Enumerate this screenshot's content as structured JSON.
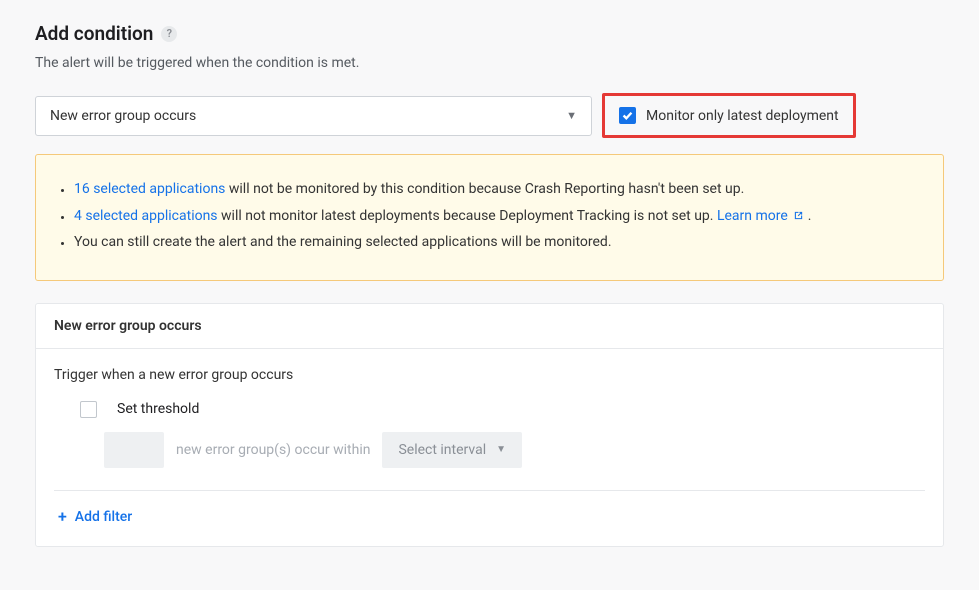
{
  "header": {
    "title": "Add condition",
    "help_icon": "?",
    "subtitle": "The alert will be triggered when the condition is met."
  },
  "condition_select": {
    "value": "New error group occurs"
  },
  "monitor_checkbox": {
    "label": "Monitor only latest deployment",
    "checked": true
  },
  "warning": {
    "items": [
      {
        "link_text": "16 selected applications",
        "text_after": " will not be monitored by this condition because Crash Reporting hasn't been set up."
      },
      {
        "link_text": "4 selected applications",
        "text_after": " will not monitor latest deployments because Deployment Tracking is not set up. ",
        "learn_more": "Learn more",
        "trailing": " ."
      },
      {
        "text_plain": "You can still create the alert and the remaining selected applications will be monitored."
      }
    ]
  },
  "card": {
    "title": "New error group occurs",
    "trigger_text": "Trigger when a new error group occurs",
    "threshold": {
      "label": "Set threshold",
      "checked": false,
      "muted_text": "new error group(s) occur within",
      "interval_placeholder": "Select interval"
    },
    "add_filter": "Add filter"
  }
}
